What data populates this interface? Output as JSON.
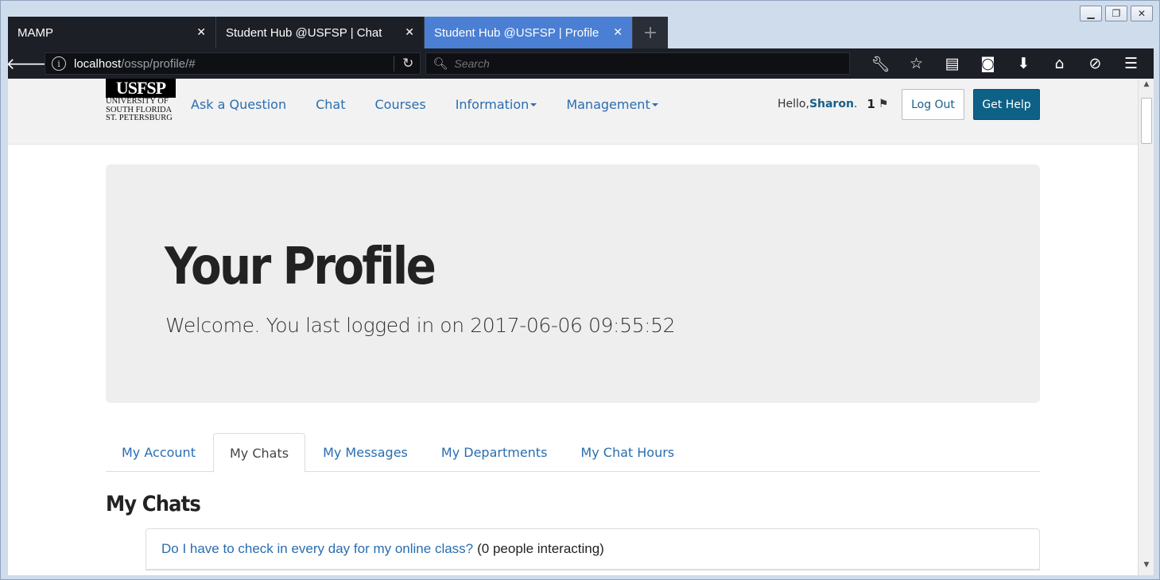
{
  "browser": {
    "tabs": [
      {
        "title": "MAMP",
        "active": false
      },
      {
        "title": "Student Hub @USFSP | Chat",
        "active": false
      },
      {
        "title": "Student Hub @USFSP | Profile",
        "active": true
      }
    ],
    "new_tab_icon": "+",
    "url_host": "localhost",
    "url_path": "/ossp/profile/#",
    "search_placeholder": "Search",
    "window_buttons": [
      "minimize",
      "maximize",
      "close"
    ],
    "toolbar_icons": [
      "wrench-icon",
      "star-icon",
      "reading-list-icon",
      "pocket-icon",
      "download-icon",
      "home-icon",
      "sync-icon",
      "menu-icon"
    ]
  },
  "site": {
    "logo": {
      "brand": "USFSP",
      "line1": "UNIVERSITY OF",
      "line2": "SOUTH FLORIDA",
      "line3": "ST. PETERSBURG"
    },
    "nav": [
      {
        "label": "Ask a Question",
        "dropdown": false
      },
      {
        "label": "Chat",
        "dropdown": false
      },
      {
        "label": "Courses",
        "dropdown": false
      },
      {
        "label": "Information",
        "dropdown": true
      },
      {
        "label": "Management",
        "dropdown": true
      }
    ],
    "greeting_prefix": "Hello, ",
    "user_name": "Sharon",
    "greeting_suffix": ".",
    "flag_count": "1",
    "logout_label": "Log Out",
    "help_label": "Get Help"
  },
  "profile": {
    "title": "Your Profile",
    "welcome": "Welcome. You last logged in on 2017-06-06 09:55:52",
    "tabs": [
      "My Account",
      "My Chats",
      "My Messages",
      "My Departments",
      "My Chat Hours"
    ],
    "active_tab": "My Chats",
    "section_title": "My Chats",
    "chats": [
      {
        "question": "Do I have to check in every day for my online class?",
        "interaction": "(0 people interacting)"
      }
    ]
  },
  "colors": {
    "link": "#2a6db0",
    "primary_button": "#0e6186",
    "active_browser_tab": "#4a7fd4"
  }
}
